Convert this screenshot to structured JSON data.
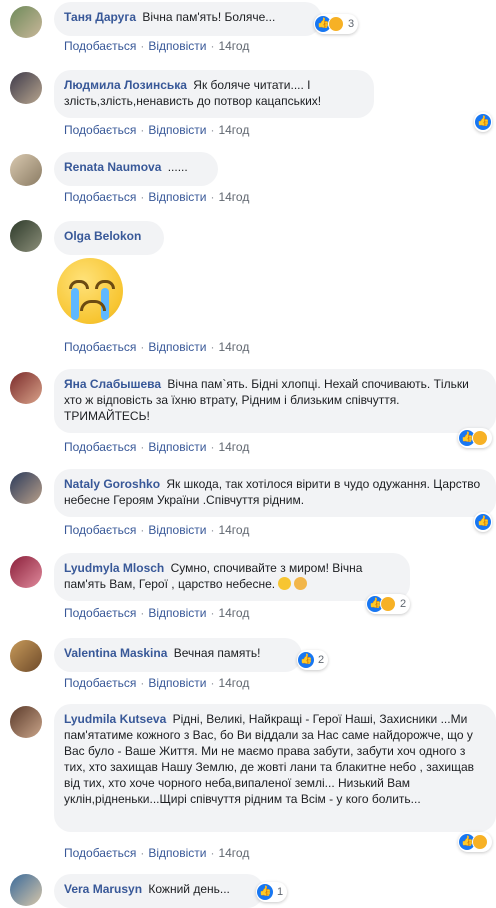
{
  "ui": {
    "like": "Подобається",
    "reply": "Відповісти",
    "time": "14год"
  },
  "comments": [
    {
      "name": "Таня Даруга",
      "text": "Вічна пам'ять! Боляче...",
      "reacts": "3"
    },
    {
      "name": "Людмила Лозинська",
      "text": "Як боляче читати.... І злість,злість,ненависть до потвор кацапських!"
    },
    {
      "name": "Renata Naumova",
      "text": "......"
    },
    {
      "name": "Olga Belokon",
      "text": ""
    },
    {
      "name": "Яна Слабышева",
      "text": "Вічна пам`ять. Бідні хлопці. Нехай спочивають. Тільки хто ж відповість за їхню втрату, Рідним і близьким співчуття. ТРИМАЙТЕСЬ!"
    },
    {
      "name": "Nataly Goroshko",
      "text": "Як шкода, так хотілося вірити в чудо одужання. Царство небесне Героям України .Співчуття рідним."
    },
    {
      "name": "Lyudmyla Mlosch",
      "text": "Сумно, спочивайте з миром! Вічна пам'ять Вам, Герої , царство небесне.",
      "reacts": "2"
    },
    {
      "name": "Valentina Maskina",
      "text": "Вечная память!",
      "reacts": "2"
    },
    {
      "name": "Lyudmila Kutseva",
      "text": "Рідні, Великі, Найкращі - Герої Наші, Захисники ...Ми пам'ятатиме кожного з Вас, бо Ви віддали за Нас саме найдорожче, що у Вас було - Ваше Життя. Ми не маємо права забути, забути хоч одного з тих, хто захищав Нашу Землю, де жовті лани та блакитне небо , захищав від тих, хто хоче чорного неба,випаленої землі... Низький Вам уклін,рідненьки...Щирі співчуття рідним та Всім - у кого болить..."
    },
    {
      "name": "Vera Marusyn",
      "text": "Кожний день...",
      "reacts": "1"
    }
  ]
}
